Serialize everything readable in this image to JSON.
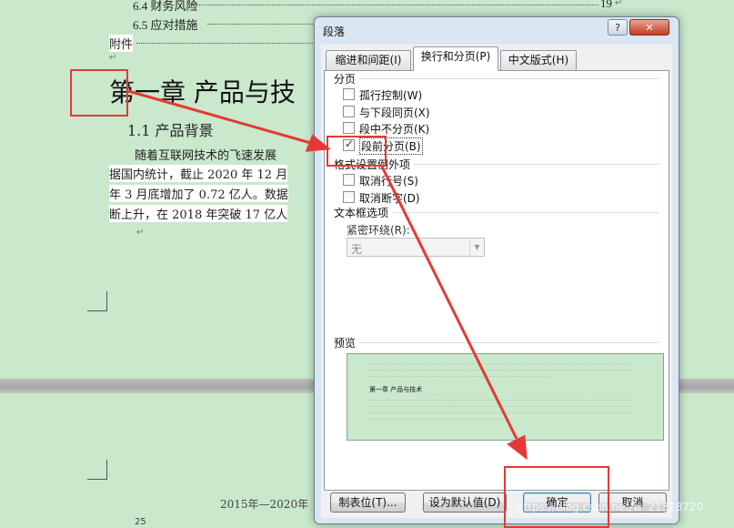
{
  "document": {
    "toc": [
      {
        "label": "6.4 财务风险",
        "page": "19"
      },
      {
        "label": "6.5 应对措施",
        "page": ""
      },
      {
        "label": "附件",
        "page": ""
      }
    ],
    "chapter_title": "第一章  产品与技",
    "section_title": "1.1  产品背景",
    "body_lines": [
      "随着互联网技术的飞速发展",
      "据国内统计，截止 2020 年 12 月",
      "年 3 月底增加了 0.72 亿人。数据",
      "断上升，在 2018 年突破 17 亿人"
    ],
    "footer": "2015年—2020年",
    "page_number": "25"
  },
  "dialog": {
    "title": "段落",
    "help_label": "?",
    "close_label": "✕",
    "tabs": [
      {
        "label": "缩进和间距(I)",
        "active": false
      },
      {
        "label": "换行和分页(P)",
        "active": true
      },
      {
        "label": "中文版式(H)",
        "active": false
      }
    ],
    "pagination": {
      "title": "分页",
      "options": [
        {
          "label": "孤行控制(W)",
          "checked": false
        },
        {
          "label": "与下段同页(X)",
          "checked": false
        },
        {
          "label": "段中不分页(K)",
          "checked": false
        },
        {
          "label": "段前分页(B)",
          "checked": true
        }
      ]
    },
    "format_exceptions": {
      "title": "格式设置例外项",
      "options": [
        {
          "label": "取消行号(S)",
          "checked": false
        },
        {
          "label": "取消断字(D)",
          "checked": false
        }
      ]
    },
    "textbox": {
      "title": "文本框选项",
      "wrap_label": "紧密环绕(R):",
      "wrap_value": "无"
    },
    "preview": {
      "title": "预览",
      "heading_text": "第一章  产品与技术",
      "sample_text": "下一段落下一段落下一段落下一段落下一段落下一段落下一段落下一段落"
    },
    "buttons": {
      "tabs": "制表位(T)...",
      "set_default": "设为默认值(D)",
      "ok": "确定",
      "cancel": "取消"
    }
  },
  "annotation_color": "#e53935",
  "watermark": "https://blog.csdn.net/w_21328720"
}
